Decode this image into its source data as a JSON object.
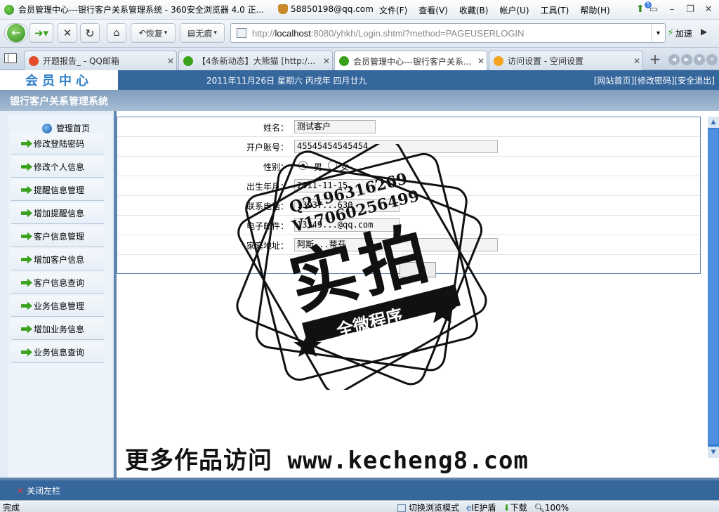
{
  "window": {
    "title": "会员管理中心---银行客户关系管理系统 - 360安全浏览器 4.0 正...",
    "account": "58850198@qq.com",
    "menu": [
      "文件(F)",
      "查看(V)",
      "收藏(B)",
      "帐户(U)",
      "工具(T)",
      "帮助(H)"
    ],
    "notify_count": "5"
  },
  "toolbar": {
    "restore_label": "恢复",
    "private_label": "无痕",
    "address_prefix": "http://",
    "address_host": "localhost",
    "address_rest": ":8080/yhkh/Login.shtml?method=PAGEUSERLOGIN",
    "speed_label": "加速"
  },
  "tabs": [
    {
      "title": "开题报告_ - QQ邮箱",
      "color": "#e44b2a"
    },
    {
      "title": "【4条新动态】大熊猫 [http:/...",
      "color": "#3aa11c"
    },
    {
      "title": "会员管理中心---银行客户关系...",
      "color": "#3aa11c"
    },
    {
      "title": "访问设置 - 空间设置",
      "color": "#f2a31f"
    }
  ],
  "header": {
    "logo": "会员中心",
    "date": "2011年11月26日 星期六 丙戌年 四月廿九",
    "links": [
      "[网站首页]",
      "[修改密码]",
      "[安全退出]"
    ],
    "system_title": "银行客户关系管理系统"
  },
  "sidebar": {
    "home": "管理首页",
    "items": [
      "修改登陆密码",
      "修改个人信息",
      "提醒信息管理",
      "增加提醒信息",
      "客户信息管理",
      "增加客户信息",
      "客户信息查询",
      "业务信息管理",
      "增加业务信息",
      "业务信息查询"
    ]
  },
  "form": {
    "name_label": "姓名：",
    "name_value": "测试客户",
    "account_label": "开户账号：",
    "account_value": "45545454545454",
    "gender_label": "性别：",
    "gender_options": [
      "男",
      "女"
    ],
    "birth_label": "出生年月：",
    "birth_value": "2011-11-15",
    "phone_label": "联系电话：",
    "phone_value": "13937...630",
    "email_label": "电子邮件：",
    "email_value": "13349...@qq.com",
    "address_label": "家庭地址：",
    "address_value": "阿斯...蒂芬"
  },
  "footer": {
    "close_sidebar": "关闭左栏"
  },
  "statusbar": {
    "text": "完成",
    "switch_mode": "切换浏览模式",
    "ie_label": "IE护盾",
    "download": "下载",
    "zoom": "100%"
  },
  "watermark": {
    "qq": "Q2196316269",
    "v": "V17060256499",
    "main": "实拍",
    "band": "全微程序",
    "bottom": "更多作品访问 www.kecheng8.com"
  }
}
